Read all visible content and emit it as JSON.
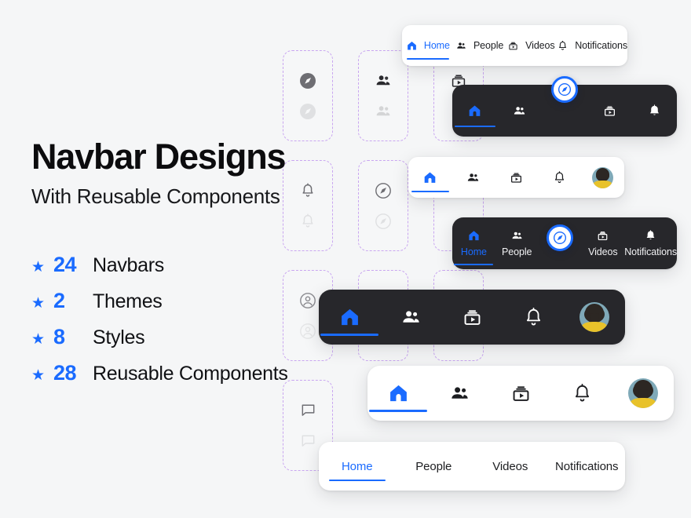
{
  "page": {
    "title": "Navbar Designs",
    "subtitle": "With Reusable Components",
    "background_color": "#f5f6f7",
    "accent_color": "#1a6bff",
    "dark_surface_color": "#27272b",
    "light_surface_color": "#ffffff",
    "placeholder_border_color": "#c9a6f0"
  },
  "features": [
    {
      "bullet": "★",
      "count": "24",
      "label": "Navbars"
    },
    {
      "bullet": "★",
      "count": "2",
      "label": "Themes"
    },
    {
      "bullet": "★",
      "count": "8",
      "label": "Styles"
    },
    {
      "bullet": "★",
      "count": "28",
      "label": "Reusable Components"
    }
  ],
  "labels": {
    "home": "Home",
    "people": "People",
    "videos": "Videos",
    "notifications": "Notifications"
  },
  "navbars": [
    {
      "id": "light-icon-label-bar",
      "theme": "light",
      "style": "icon-with-label-horizontal",
      "items": [
        {
          "icon": "home-icon",
          "label": "Home",
          "active": true
        },
        {
          "icon": "people-icon",
          "label": "People",
          "active": false
        },
        {
          "icon": "videos-icon",
          "label": "Videos",
          "active": false
        },
        {
          "icon": "bell-icon",
          "label": "Notifications",
          "active": false
        }
      ]
    },
    {
      "id": "dark-icon-fab-bar",
      "theme": "dark",
      "style": "icon-only-with-center-fab",
      "items": [
        {
          "icon": "home-icon",
          "label": "Home",
          "active": true
        },
        {
          "icon": "people-icon",
          "label": "People",
          "active": false
        },
        {
          "icon": "compass-icon",
          "label": "Explore",
          "active": false,
          "floating": true
        },
        {
          "icon": "videos-icon",
          "label": "Videos",
          "active": false
        },
        {
          "icon": "bell-icon",
          "label": "Notifications",
          "active": false
        }
      ]
    },
    {
      "id": "light-icon-avatar-bar",
      "theme": "light",
      "style": "icon-only-with-avatar",
      "items": [
        {
          "icon": "home-icon",
          "label": "Home",
          "active": true
        },
        {
          "icon": "people-icon",
          "label": "People",
          "active": false
        },
        {
          "icon": "videos-icon",
          "label": "Videos",
          "active": false
        },
        {
          "icon": "bell-icon",
          "label": "Notifications",
          "active": false
        },
        {
          "icon": "avatar",
          "label": "Profile",
          "active": false
        }
      ]
    },
    {
      "id": "dark-label-fab-bar",
      "theme": "dark",
      "style": "icon-with-label-and-center-fab",
      "items": [
        {
          "icon": "home-icon",
          "label": "Home",
          "active": true
        },
        {
          "icon": "people-icon",
          "label": "People",
          "active": false
        },
        {
          "icon": "compass-icon",
          "label": "Explore",
          "active": false,
          "floating": true
        },
        {
          "icon": "videos-icon",
          "label": "Videos",
          "active": false
        },
        {
          "icon": "bell-icon",
          "label": "Notifications",
          "active": false
        }
      ]
    },
    {
      "id": "dark-large-icon-avatar-bar",
      "theme": "dark",
      "style": "large-icon-only-with-avatar",
      "items": [
        {
          "icon": "home-icon",
          "label": "Home",
          "active": true
        },
        {
          "icon": "people-icon",
          "label": "People",
          "active": false
        },
        {
          "icon": "videos-icon",
          "label": "Videos",
          "active": false
        },
        {
          "icon": "bell-icon",
          "label": "Notifications",
          "active": false
        },
        {
          "icon": "avatar",
          "label": "Profile",
          "active": false
        }
      ]
    },
    {
      "id": "light-large-icon-avatar-bar",
      "theme": "light",
      "style": "large-icon-only-with-avatar",
      "items": [
        {
          "icon": "home-icon",
          "label": "Home",
          "active": true
        },
        {
          "icon": "people-icon",
          "label": "People",
          "active": false
        },
        {
          "icon": "videos-icon",
          "label": "Videos",
          "active": false
        },
        {
          "icon": "bell-icon",
          "label": "Notifications",
          "active": false
        },
        {
          "icon": "avatar",
          "label": "Profile",
          "active": false
        }
      ]
    },
    {
      "id": "light-text-tab-bar",
      "theme": "light",
      "style": "text-only",
      "items": [
        {
          "icon": null,
          "label": "Home",
          "active": true
        },
        {
          "icon": null,
          "label": "People",
          "active": false
        },
        {
          "icon": null,
          "label": "Videos",
          "active": false
        },
        {
          "icon": null,
          "label": "Notifications",
          "active": false
        }
      ]
    }
  ],
  "placeholders": [
    {
      "id": "ph-compass-filled",
      "icon": "compass-filled-icon"
    },
    {
      "id": "ph-people",
      "icon": "people-icon"
    },
    {
      "id": "ph-videos",
      "icon": "videos-icon"
    },
    {
      "id": "ph-bell",
      "icon": "bell-icon"
    },
    {
      "id": "ph-compass-outline",
      "icon": "compass-outline-icon"
    },
    {
      "id": "ph-compass-outline-2",
      "icon": "compass-outline-icon"
    },
    {
      "id": "ph-person-circle",
      "icon": "person-circle-icon"
    },
    {
      "id": "ph-blank-1",
      "icon": "blank-icon"
    },
    {
      "id": "ph-blank-2",
      "icon": "blank-icon"
    },
    {
      "id": "ph-chat",
      "icon": "chat-bubble-icon"
    }
  ]
}
